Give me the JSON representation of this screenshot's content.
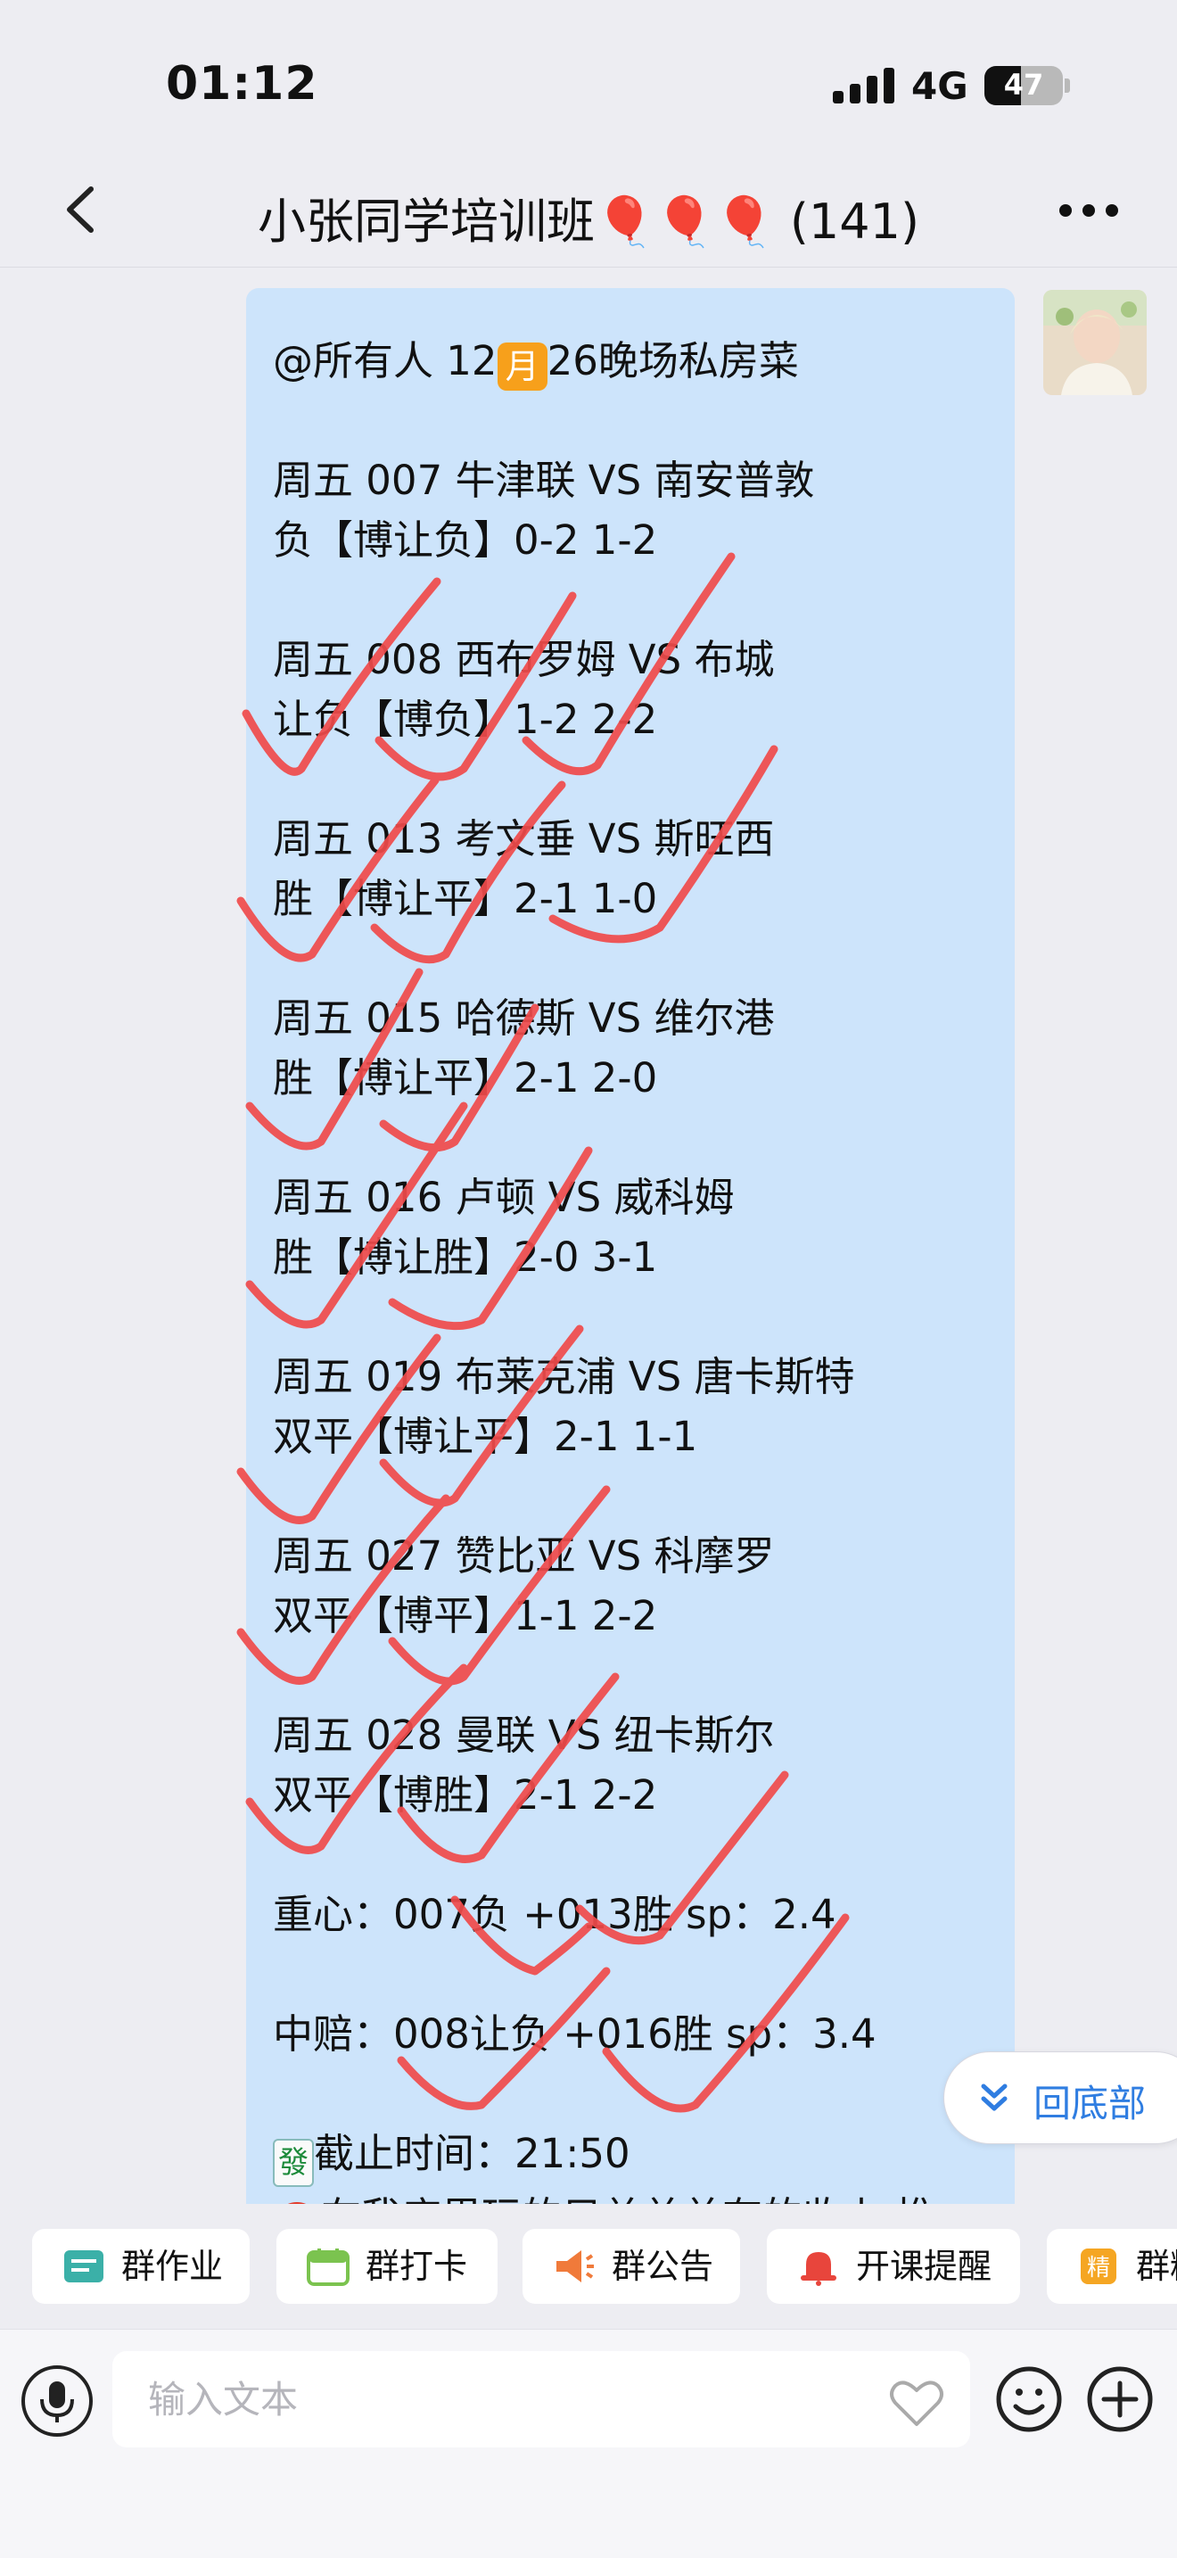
{
  "status_bar": {
    "time": "01:12",
    "network": "4G",
    "battery": "47",
    "battery_level": 0.47
  },
  "header": {
    "title": "小张同学培训班🎈🎈🎈 (141)"
  },
  "message": {
    "mention": "@所有人 12",
    "month_emoji": "月",
    "mention_tail": "26晚场私房菜",
    "matches": [
      {
        "line1": "周五 007 牛津联 VS 南安普敦",
        "line2": "负【博让负】0-2 1-2"
      },
      {
        "line1": "周五 008 西布罗姆 VS 布城",
        "line2": "让负【博负】1-2 2-2"
      },
      {
        "line1": "周五 013 考文垂 VS 斯旺西",
        "line2": "胜【博让平】2-1 1-0"
      },
      {
        "line1": "周五 015 哈德斯 VS 维尔港",
        "line2": "胜【博让平】2-1 2-0"
      },
      {
        "line1": "周五 016 卢顿 VS 威科姆",
        "line2": "胜【博让胜】2-0 3-1"
      },
      {
        "line1": "周五 019 布莱克浦 VS 唐卡斯特",
        "line2": "双平【博让平】2-1 1-1"
      },
      {
        "line1": "周五 027 赞比亚 VS 科摩罗",
        "line2": "双平【博平】1-1 2-2"
      },
      {
        "line1": "周五 028 曼联 VS 纽卡斯尔",
        "line2": "双平【博胜】2-1 2-2"
      }
    ],
    "focus": "重心：007负 +013胜 sp：2.4",
    "mid": "中赔：008让负 +016胜 sp：3.4",
    "fa_emoji": "發",
    "deadline": "截止时间：21:50",
    "zhu_emoji": "祝",
    "last_line": "在我店里玩的只单单单有的收上 推"
  },
  "scroll_to_bottom": "回底部",
  "quick_actions": [
    {
      "label": "群作业",
      "icon": "homework-icon",
      "color": "#3bb0a8"
    },
    {
      "label": "群打卡",
      "icon": "checkin-icon",
      "color": "#7bc34f"
    },
    {
      "label": "群公告",
      "icon": "announcement-icon",
      "color": "#f07a3a"
    },
    {
      "label": "开课提醒",
      "icon": "bell-icon",
      "color": "#e8453c"
    },
    {
      "label": "群精",
      "icon": "featured-icon",
      "color": "#f5a623"
    }
  ],
  "input": {
    "placeholder": "输入文本"
  }
}
